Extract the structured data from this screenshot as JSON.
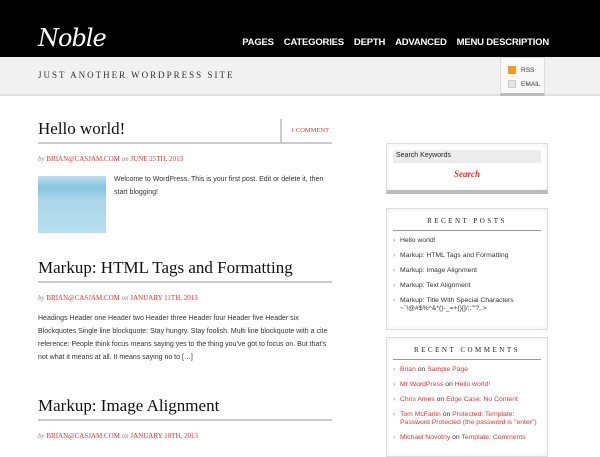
{
  "site": {
    "title": "Noble",
    "tagline": "JUST ANOTHER WORDPRESS SITE"
  },
  "nav": [
    "PAGES",
    "CATEGORIES",
    "DEPTH",
    "ADVANCED",
    "MENU DESCRIPTION"
  ],
  "social": {
    "rss": "RSS",
    "email": "EMAIL"
  },
  "posts": [
    {
      "title": "Hello world!",
      "comments": "1 COMMENT",
      "by": "by",
      "author": "BRIAN@CASJAM.COM",
      "on": "on",
      "date": "JUNE 25TH, 2013",
      "excerpt": "Welcome to WordPress. This is your first post. Edit or delete it, then start blogging!"
    },
    {
      "title": "Markup: HTML Tags and Formatting",
      "by": "by",
      "author": "BRIAN@CASJAM.COM",
      "on": "on",
      "date": "JANUARY 11TH, 2013",
      "excerpt": "Headings Header one Header two Header three Header four Header five Header six Blockquotes Single line blockquote: Stay hungry. Stay foolish. Multi line blockquote with a cite reference: People think focus means saying yes to the thing you’ve got to focus on. But that’s not what it means at all. It means saying no to […]"
    },
    {
      "title": "Markup: Image Alignment",
      "by": "by",
      "author": "BRIAN@CASJAM.COM",
      "on": "on",
      "date": "JANUARY 10TH, 2013"
    }
  ],
  "search": {
    "placeholder": "Search Keywords",
    "button": "Search"
  },
  "recent_posts": {
    "title": "RECENT POSTS",
    "items": [
      "Hello world!",
      "Markup: HTML Tags and Formatting",
      "Markup: Image Alignment",
      "Markup: Text Alignment",
      "Markup: Title With Special Characters ~`!@#$%^&*()-_=+{}[]/;:'\"?,.>"
    ]
  },
  "recent_comments": {
    "title": "RECENT COMMENTS",
    "on": "on",
    "items": [
      {
        "author": "Brian",
        "post": "Sample Page"
      },
      {
        "author": "Mr WordPress",
        "post": "Hello world!"
      },
      {
        "author": "Chris Ames",
        "post": "Edge Case: No Content"
      },
      {
        "author": "Tom McFarlin",
        "post": "Protected: Template: Password Protected (the password is \"enter\")"
      },
      {
        "author": "Michael Novotny",
        "post": "Template: Comments"
      }
    ]
  }
}
